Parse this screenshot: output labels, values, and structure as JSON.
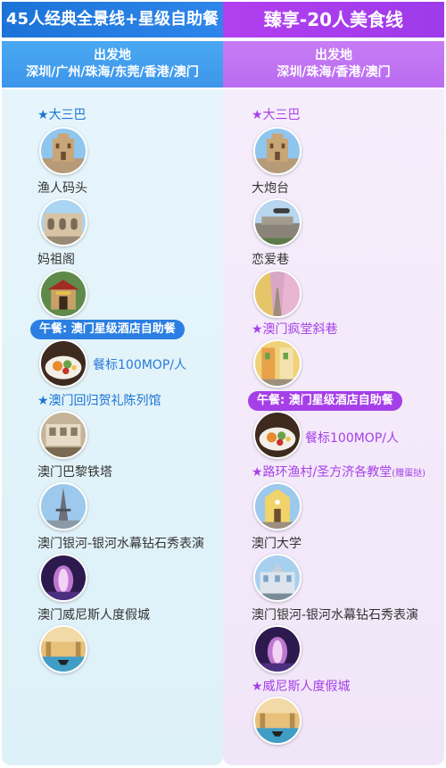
{
  "left": {
    "title": "45人经典全景线+星级自助餐",
    "origin_label": "出发地",
    "origins": "深圳/广州/珠海/东莞/香港/澳门",
    "items": {
      "i1": "★大三巴",
      "i2": "渔人码头",
      "i3": "妈祖阁",
      "lunch": "午餐: 澳门星级酒店自助餐",
      "price": "餐标100MOP/人",
      "i4": "★澳门回归贺礼陈列馆",
      "i5": "澳门巴黎铁塔",
      "i6": "澳门银河-银河水幕钻石秀表演",
      "i7": "澳门威尼斯人度假城"
    }
  },
  "right": {
    "title": "臻享-20人美食线",
    "origin_label": "出发地",
    "origins": "深圳/珠海/香港/澳门",
    "items": {
      "i1": "★大三巴",
      "i2": "大炮台",
      "i3": "恋爱巷",
      "i4": "★澳门疯堂斜巷",
      "lunch": "午餐: 澳门星级酒店自助餐",
      "price": "餐标100MOP/人",
      "i5": "★路环渔村/圣方济各教堂",
      "i5_note": "(赠蛋挞)",
      "i6": "澳门大学",
      "i7": "澳门银河-银河水幕钻石秀表演",
      "i8": "★威尼斯人度假城"
    }
  },
  "colors": {
    "left_accent": "#1a73d6",
    "right_accent": "#a53fe8"
  },
  "icons": [
    "ruins-photo",
    "wharf-photo",
    "temple-photo",
    "buffet-photo",
    "museum-photo",
    "eiffel-photo",
    "fountain-photo",
    "venetian-photo",
    "fortress-photo",
    "alley-photo",
    "church-photo",
    "university-photo",
    "galaxy-photo"
  ]
}
